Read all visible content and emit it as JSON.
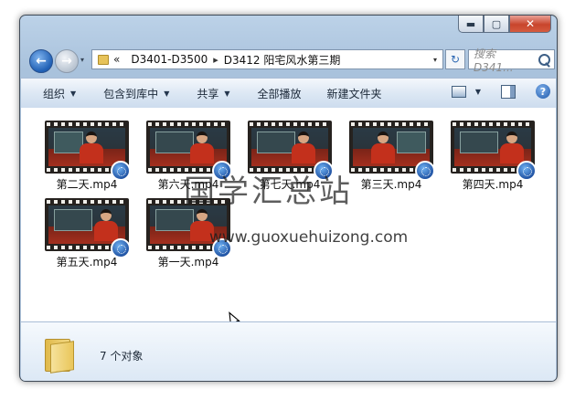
{
  "window": {
    "caption_buttons": {
      "minimize": "▬",
      "maximize": "▢",
      "close": "✕"
    }
  },
  "nav": {
    "back_icon": "←",
    "forward_icon": "→",
    "history_dropdown": "▾"
  },
  "address": {
    "prefix": "«",
    "crumbs": [
      "D3401-D3500",
      "D3412 阳宅风水第三期"
    ],
    "separator": "▸",
    "dropdown": "▾",
    "refresh_icon": "↻"
  },
  "search": {
    "placeholder": "搜索 D341..."
  },
  "commands": {
    "organize": "组织",
    "include_library": "包含到库中",
    "share": "共享",
    "play_all": "全部播放",
    "new_folder": "新建文件夹",
    "help": "?"
  },
  "files": [
    {
      "name": "第二天.mp4"
    },
    {
      "name": "第六天.mp4"
    },
    {
      "name": "第七天.mp4"
    },
    {
      "name": "第三天.mp4"
    },
    {
      "name": "第四天.mp4"
    },
    {
      "name": "第五天.mp4"
    },
    {
      "name": "第一天.mp4"
    }
  ],
  "watermark": {
    "title": "国学汇总站",
    "url": "www.guoxuehuizong.com"
  },
  "details": {
    "count_text": "7 个对象"
  }
}
